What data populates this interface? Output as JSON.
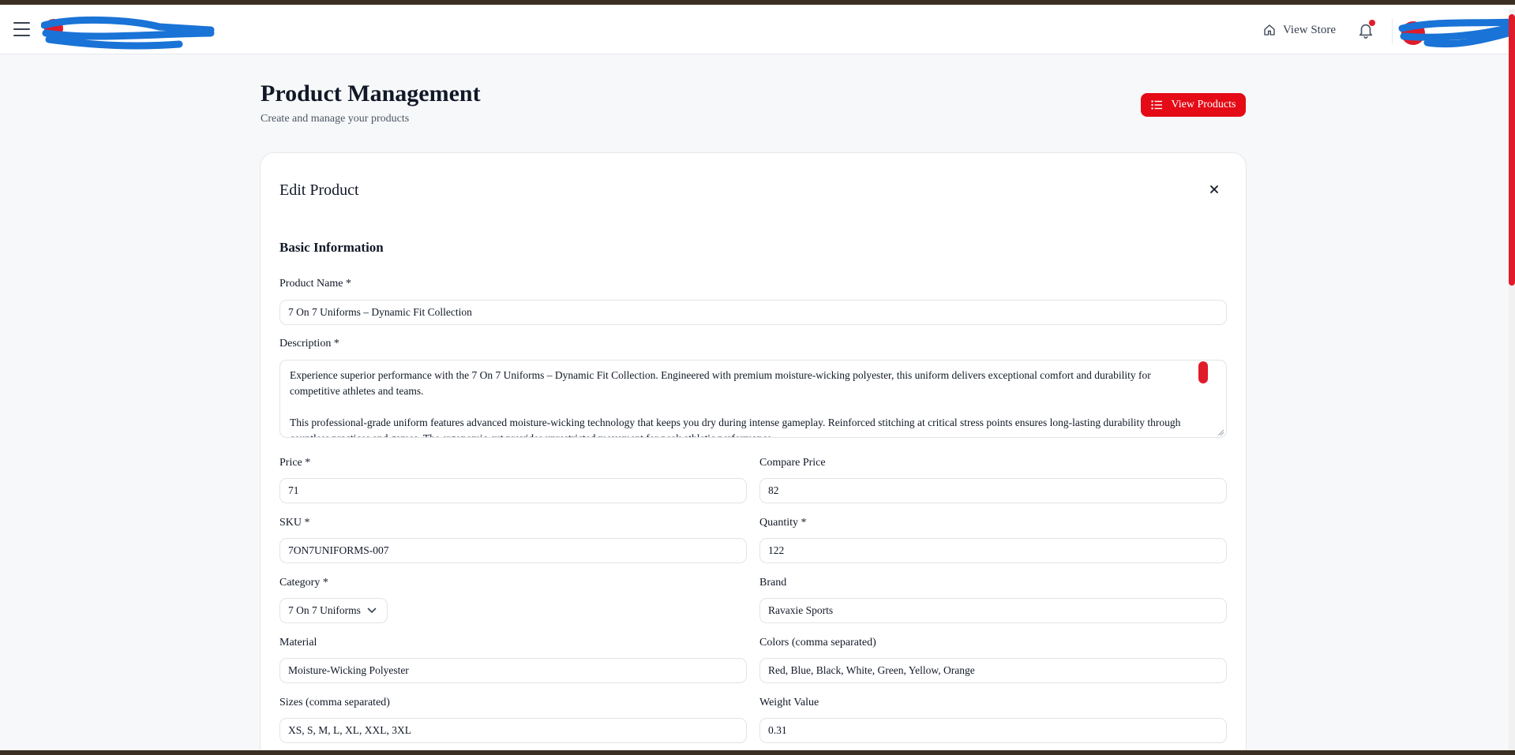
{
  "topbar": {
    "view_store_label": "View Store",
    "icons": {
      "menu": "hamburger-icon",
      "home": "home-icon",
      "notifications": "bell-icon"
    }
  },
  "header": {
    "title": "Product Management",
    "subtitle": "Create and manage your products",
    "view_products_label": "View Products"
  },
  "form": {
    "card_title": "Edit Product",
    "section_title": "Basic Information",
    "product_name": {
      "label": "Product Name *",
      "value": "7 On 7 Uniforms – Dynamic Fit Collection"
    },
    "description": {
      "label": "Description *",
      "paragraphs": [
        "Experience superior performance with the 7 On 7 Uniforms – Dynamic Fit Collection. Engineered with premium moisture-wicking polyester, this uniform delivers exceptional comfort and durability for competitive athletes and teams.",
        "This professional-grade uniform features advanced moisture-wicking technology that keeps you dry during intense gameplay. Reinforced stitching at critical stress points ensures long-lasting durability through countless practices and games. The ergonomic cut provides unrestricted movement for peak athletic performance."
      ]
    },
    "price": {
      "label": "Price *",
      "value": "71"
    },
    "compare_price": {
      "label": "Compare Price",
      "value": "82"
    },
    "sku": {
      "label": "SKU *",
      "value": "7ON7UNIFORMS-007"
    },
    "quantity": {
      "label": "Quantity *",
      "value": "122"
    },
    "category": {
      "label": "Category *",
      "value": "7 On 7 Uniforms"
    },
    "brand": {
      "label": "Brand",
      "value": "Ravaxie Sports"
    },
    "material": {
      "label": "Material",
      "value": "Moisture-Wicking Polyester"
    },
    "colors": {
      "label": "Colors (comma separated)",
      "value": "Red, Blue, Black, White, Green, Yellow, Orange"
    },
    "sizes": {
      "label": "Sizes (comma separated)",
      "value": "XS, S, M, L, XL, XXL, 3XL"
    },
    "weight": {
      "label": "Weight Value",
      "value": "0.31"
    }
  },
  "colors": {
    "accent": "#e40b16",
    "scrollbar": "#e01b2a",
    "logo_scribble": "#1a73d6"
  }
}
